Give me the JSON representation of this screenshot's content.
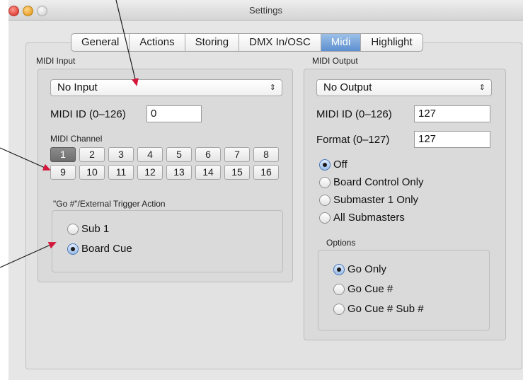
{
  "window": {
    "title": "Settings"
  },
  "tabs": [
    "General",
    "Actions",
    "Storing",
    "DMX In/OSC",
    "Midi",
    "Highlight"
  ],
  "active_tab": "Midi",
  "midi_input": {
    "section_label": "MIDI Input",
    "select_value": "No Input",
    "midi_id_label": "MIDI ID (0–126)",
    "midi_id_value": "0",
    "channel_label": "MIDI Channel",
    "channels": [
      "1",
      "2",
      "3",
      "4",
      "5",
      "6",
      "7",
      "8",
      "9",
      "10",
      "11",
      "12",
      "13",
      "14",
      "15",
      "16"
    ],
    "selected_channel": "1",
    "trigger_label": "\"Go #\"/External Trigger Action",
    "trigger_options": [
      "Sub 1",
      "Board Cue"
    ],
    "trigger_selected": "Board Cue"
  },
  "midi_output": {
    "section_label": "MIDI Output",
    "select_value": "No Output",
    "midi_id_label": "MIDI ID (0–126)",
    "midi_id_value": "127",
    "format_label": "Format (0–127)",
    "format_value": "127",
    "modes": [
      "Off",
      "Board Control Only",
      "Submaster 1 Only",
      "All Submasters"
    ],
    "mode_selected": "Off",
    "options_label": "Options",
    "options": [
      "Go Only",
      "Go Cue #",
      "Go Cue # Sub #"
    ],
    "option_selected": "Go Only"
  },
  "select_arrows": "⇕",
  "colors": {
    "active_tab": "#5d8fd0",
    "annotation_arrow": "#d4163b",
    "selected_channel": "#777777"
  }
}
